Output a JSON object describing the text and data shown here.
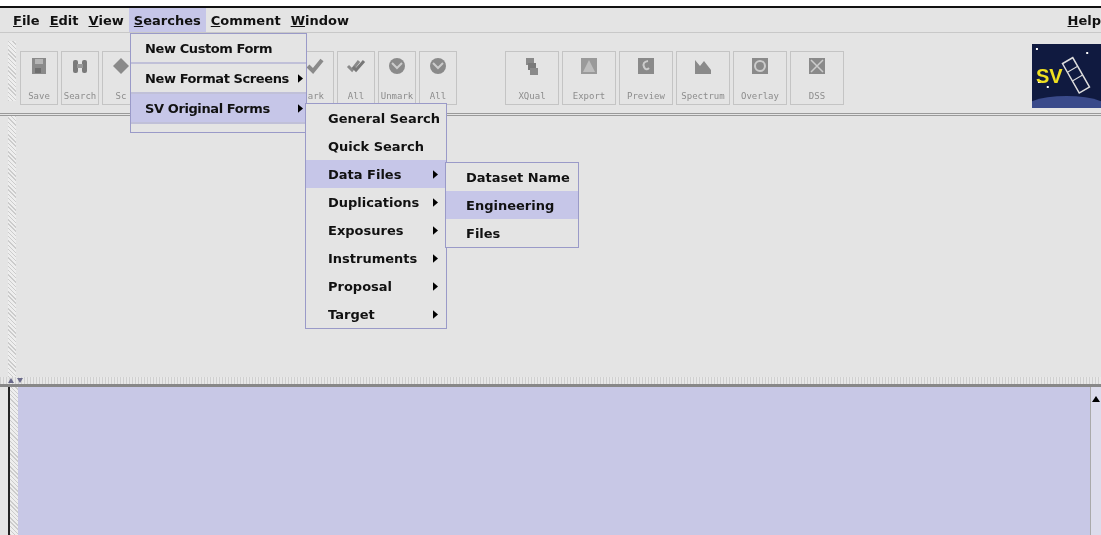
{
  "menu_bar": [
    {
      "label": "File",
      "selected": false
    },
    {
      "label": "Edit",
      "selected": false
    },
    {
      "label": "View",
      "selected": false
    },
    {
      "label": "Searches",
      "selected": true
    },
    {
      "label": "Comment",
      "selected": false
    },
    {
      "label": "Window",
      "selected": false
    },
    {
      "label": "Help",
      "selected": false
    }
  ],
  "toolbar": {
    "groups": [
      [
        {
          "label": "Save"
        },
        {
          "label": "Search"
        },
        {
          "label": "Sc"
        }
      ],
      [
        {
          "label": "ark"
        },
        {
          "label": "All"
        },
        {
          "label": "Unmark"
        },
        {
          "label": "All"
        }
      ],
      [
        {
          "label": "XQual"
        },
        {
          "label": "Export"
        },
        {
          "label": "Preview"
        },
        {
          "label": "Spectrum"
        },
        {
          "label": "Overlay"
        },
        {
          "label": "DSS"
        }
      ]
    ],
    "logo": "SV"
  },
  "searches_menu": [
    {
      "label": "New Custom Form",
      "submenu": false,
      "selected": false
    },
    {
      "label": "New Format Screens",
      "submenu": true,
      "selected": false
    },
    {
      "label": "SV Original Forms",
      "submenu": true,
      "selected": true
    }
  ],
  "sv_original_forms_menu": [
    {
      "label": "General Search",
      "submenu": false,
      "selected": false
    },
    {
      "label": "Quick Search",
      "submenu": false,
      "selected": false
    },
    {
      "label": "Data Files",
      "submenu": true,
      "selected": true
    },
    {
      "label": "Duplications",
      "submenu": true,
      "selected": false
    },
    {
      "label": "Exposures",
      "submenu": true,
      "selected": false
    },
    {
      "label": "Instruments",
      "submenu": true,
      "selected": false
    },
    {
      "label": "Proposal",
      "submenu": true,
      "selected": false
    },
    {
      "label": "Target",
      "submenu": true,
      "selected": false
    }
  ],
  "data_files_menu": [
    {
      "label": "Dataset Name",
      "submenu": false,
      "selected": false
    },
    {
      "label": "Engineering",
      "submenu": false,
      "selected": true
    },
    {
      "label": "Files",
      "submenu": false,
      "selected": false
    }
  ]
}
